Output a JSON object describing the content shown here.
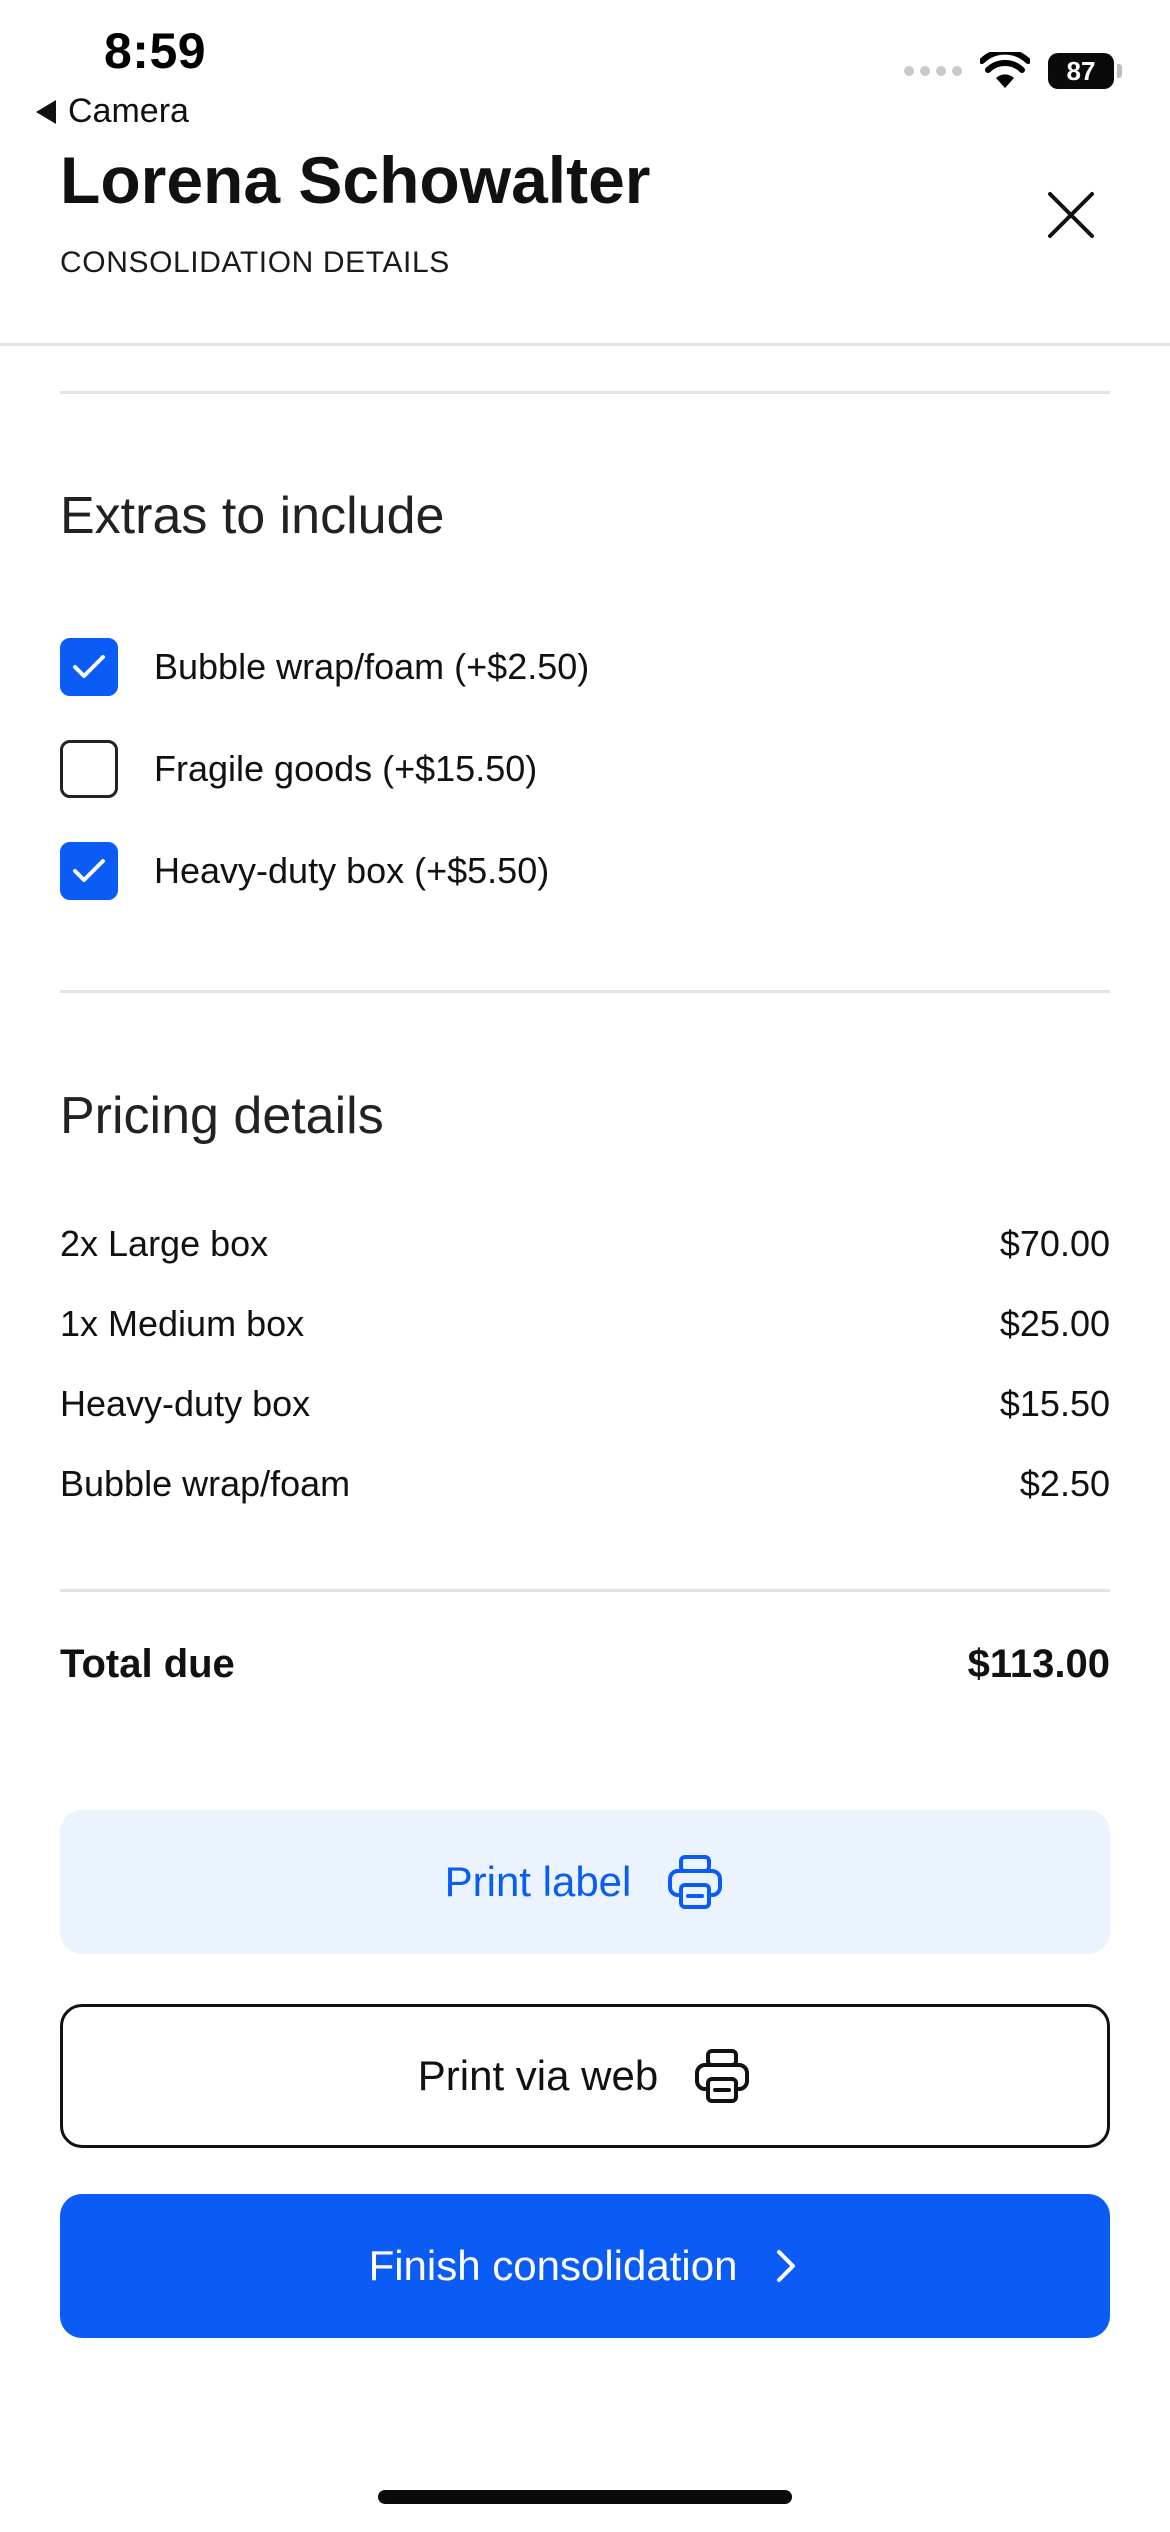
{
  "status_bar": {
    "time": "8:59",
    "back_label": "Camera",
    "battery": "87"
  },
  "header": {
    "title": "Lorena Schowalter",
    "subtitle": "CONSOLIDATION DETAILS",
    "close_icon": "close-icon"
  },
  "extras": {
    "title": "Extras to include",
    "items": [
      {
        "label": "Bubble wrap/foam (+$2.50)",
        "checked": true
      },
      {
        "label": "Fragile goods (+$15.50)",
        "checked": false
      },
      {
        "label": "Heavy-duty box (+$5.50)",
        "checked": true
      }
    ]
  },
  "pricing": {
    "title": "Pricing details",
    "rows": [
      {
        "label": "2x Large box",
        "amount": "$70.00"
      },
      {
        "label": "1x Medium box",
        "amount": "$25.00"
      },
      {
        "label": "Heavy-duty box",
        "amount": "$15.50"
      },
      {
        "label": "Bubble wrap/foam",
        "amount": "$2.50"
      }
    ],
    "total_label": "Total due",
    "total_amount": "$113.00"
  },
  "actions": {
    "print_label": "Print label",
    "print_via_web": "Print via web",
    "finish": "Finish consolidation"
  },
  "colors": {
    "accent": "#0a5cf5",
    "accent_light": "#eaf3fe"
  }
}
